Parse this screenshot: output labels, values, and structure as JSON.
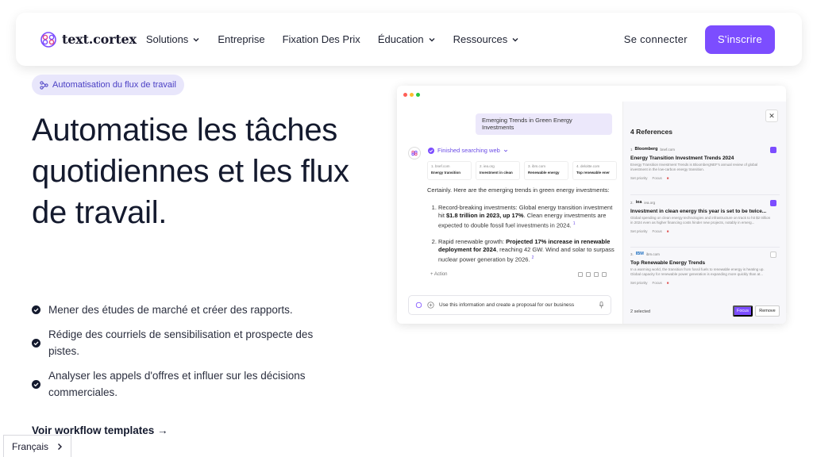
{
  "nav": {
    "logo_text": "text.cortex",
    "items": [
      {
        "label": "Solutions",
        "dropdown": true
      },
      {
        "label": "Entreprise",
        "dropdown": false
      },
      {
        "label": "Fixation Des Prix",
        "dropdown": false
      },
      {
        "label": "Éducation",
        "dropdown": true
      },
      {
        "label": "Ressources",
        "dropdown": true
      }
    ],
    "login_label": "Se connecter",
    "signup_label": "S'inscrire"
  },
  "badge": {
    "label": "Automatisation du flux de travail"
  },
  "hero": {
    "title": "Automatise les tâches quotidiennes et les flux de travail.",
    "features": [
      "Mener des études de marché et créer des rapports.",
      "Rédige des courriels de sensibilisation et prospecte des pistes.",
      "Analyser les appels d'offres et influer sur les décisions commerciales."
    ],
    "workflow_link": "Voir workflow templates →"
  },
  "language": {
    "selected": "Français"
  },
  "mockup": {
    "query": "Emerging Trends in Green Energy Investments",
    "status": "Finished searching web",
    "sources": [
      {
        "top": "1. bnef.com",
        "bottom": "Energy transition"
      },
      {
        "top": "2. iea.org",
        "bottom": "Investment in clean"
      },
      {
        "top": "3. ibm.com",
        "bottom": "Renewable energy"
      },
      {
        "top": "4. deloitte.com",
        "bottom": "Top renewable ener"
      }
    ],
    "intro": "Certainly. Here are the emerging trends in green energy investments:",
    "point1_pre": "Record-breaking investments: Global energy transition investment hit ",
    "point1_bold": "$1.8 trillion in 2023, up 17%",
    "point1_post": ". Clean energy investments are expected to double fossil fuel investments in 2024.",
    "point1_cite": "1",
    "point2_pre": "Rapid renewable growth: ",
    "point2_bold": "Projected 17% increase in renewable deployment for 2024",
    "point2_post": ", reaching 42 GW. Wind and solar to surpass nuclear power generation by 2026.",
    "point2_cite": "2",
    "action_label": "+ Action",
    "composer_text": "Use this information and create a proposal for our business",
    "refs_title": "4 References",
    "refs": [
      {
        "src_name": "Bloomberg",
        "src_domain": "bnef.com",
        "num": "1",
        "title": "Energy Transition Investment Trends 2024",
        "desc": "Energy Transition Investment Trends is BloombergNEF's annual review of global investment in the low-carbon energy transition.",
        "checked": true
      },
      {
        "src_name": "iea",
        "src_domain": "iea.org",
        "num": "2.",
        "title": "Investment in clean energy this year is set to be twice...",
        "desc": "Global spending on clean energy technologies and infrastructure on track to hit $2 trillion in 2024 even as higher financing costs hinder new projects, notably in emerg...",
        "checked": true
      },
      {
        "src_name": "IBM",
        "src_domain": "ibm.com",
        "num": "3.",
        "title": "Top Renewable Energy Trends",
        "desc": "In a warming world, the transition from fossil fuels to renewable energy is heating up. Global capacity for renewable power generation is expanding more quickly than at...",
        "checked": false
      }
    ],
    "ref_actions": [
      "Set priority",
      "Focus"
    ],
    "selected_label": "2 selected",
    "focus_label": "Focus",
    "remove_label": "Remove"
  },
  "colors": {
    "accent": "#7c4dff",
    "badge_bg": "#e8e6fb",
    "badge_text": "#4a3fc4",
    "query_bg": "#ece8fb"
  }
}
